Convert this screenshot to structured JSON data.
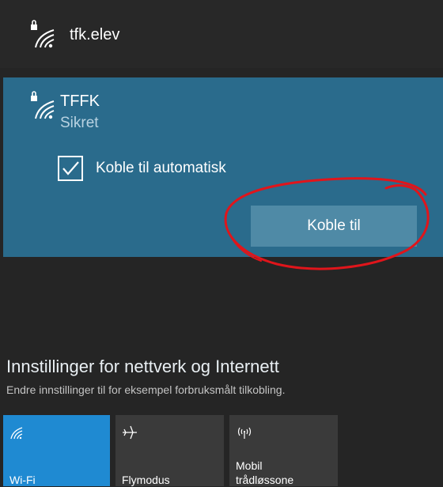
{
  "networks": [
    {
      "name": "tfk.elev"
    },
    {
      "name": "TFFK",
      "status": "Sikret",
      "auto_connect_label": "Koble til automatisk",
      "auto_connect_checked": true,
      "connect_label": "Koble til"
    }
  ],
  "settings": {
    "title": "Innstillinger for nettverk og Internett",
    "description": "Endre innstillinger til for eksempel forbruksmålt tilkobling."
  },
  "quick_actions": [
    {
      "label_lines": [
        "Wi-Fi"
      ],
      "icon": "wifi-icon",
      "active": true
    },
    {
      "label_lines": [
        "Flymodus"
      ],
      "icon": "airplane-icon",
      "active": false
    },
    {
      "label_lines": [
        "Mobil",
        "trådløssone"
      ],
      "icon": "hotspot-icon",
      "active": false
    }
  ],
  "colors": {
    "background": "#252525",
    "selected_network": "#2a6b8c",
    "connect_button": "#4f8aa6",
    "active_tile": "#1f8ad2",
    "inactive_tile": "#3a3a3a",
    "annotation": "#e0151b"
  }
}
